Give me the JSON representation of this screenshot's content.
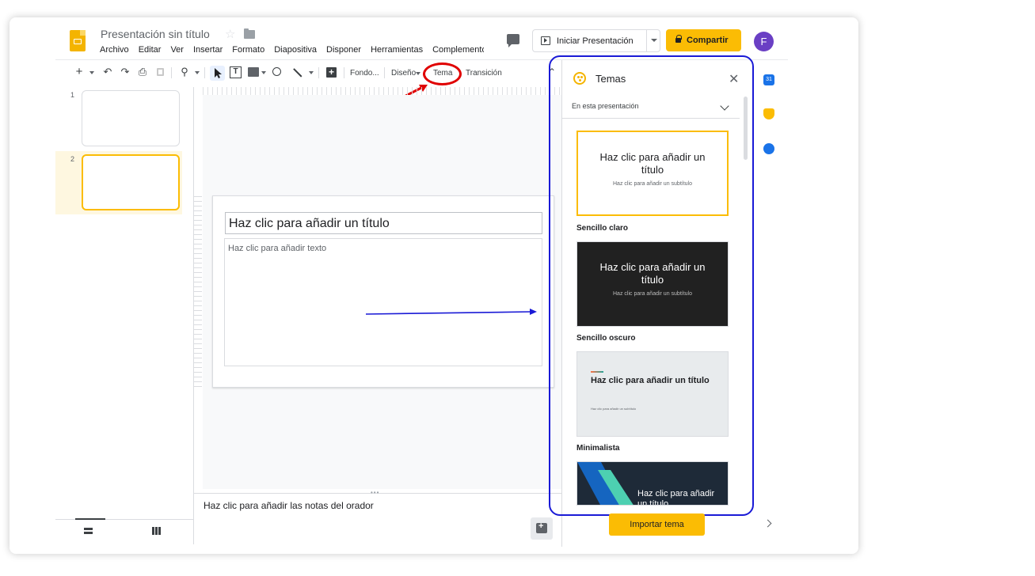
{
  "header": {
    "doc_title": "Presentación sin título",
    "star_icon": "☆",
    "menu": [
      "Archivo",
      "Editar",
      "Ver",
      "Insertar",
      "Formato",
      "Diapositiva",
      "Disponer",
      "Herramientas",
      "Complementos"
    ],
    "present_label": "Iniciar Presentación",
    "share_label": "Compartir",
    "avatar_initial": "F"
  },
  "toolbar": {
    "add": "+",
    "undo": "↶",
    "redo": "↷",
    "print": "⎙",
    "zoom": "⚲",
    "comment_add": "⊞",
    "background": "Fondo...",
    "layout": "Diseño",
    "theme": "Tema",
    "transition": "Transición",
    "collapse": "⌃"
  },
  "filmstrip": {
    "slides": [
      {
        "num": "1"
      },
      {
        "num": "2"
      }
    ],
    "selected": 2
  },
  "slide": {
    "title_placeholder": "Haz clic para añadir un título",
    "body_placeholder": "Haz clic para añadir texto"
  },
  "notes": {
    "placeholder": "Haz clic para añadir las notas del orador"
  },
  "themes_panel": {
    "title": "Temas",
    "close": "✕",
    "section": "En esta presentación",
    "themes": [
      {
        "name": "Sencillo claro",
        "title": "Haz clic para añadir un título",
        "subtitle": "Haz clic para añadir un subtítulo"
      },
      {
        "name": "Sencillo oscuro",
        "title": "Haz clic para añadir un título",
        "subtitle": "Haz clic para añadir un subtítulo"
      },
      {
        "name": "Minimalista",
        "title": "Haz clic para añadir un título",
        "subtitle": "Haz clic para añadir un subtítulo"
      },
      {
        "name": "",
        "title": "Haz clic para añadir un título",
        "subtitle": ""
      }
    ],
    "import_label": "Importar tema"
  },
  "side_rail": {
    "calendar_day": "31"
  },
  "colors": {
    "accent": "#fbbc04",
    "annotation_red": "#e00000",
    "annotation_blue": "#1a1ad6",
    "avatar": "#6a3fc4"
  }
}
